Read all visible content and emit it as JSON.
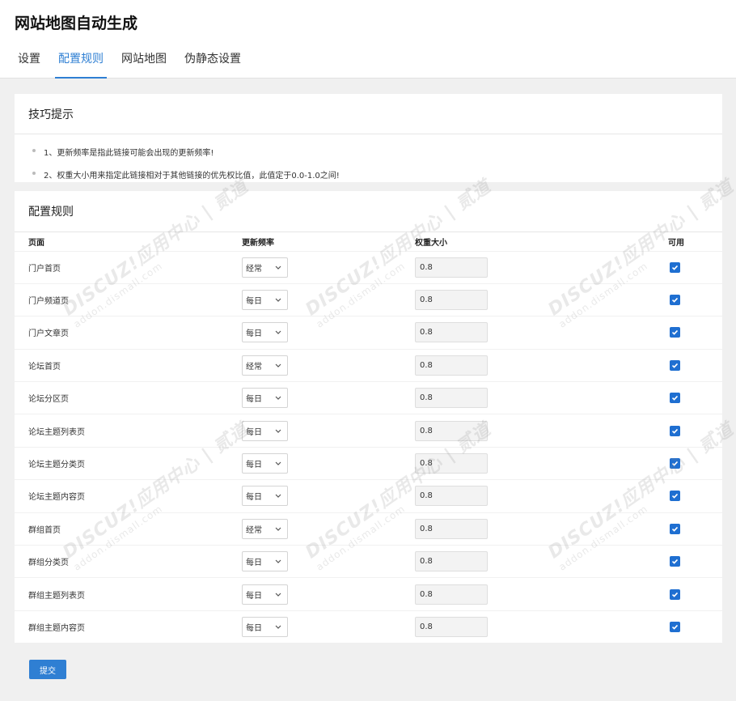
{
  "header": {
    "title": "网站地图自动生成",
    "tabs": [
      {
        "label": "设置",
        "active": false
      },
      {
        "label": "配置规则",
        "active": true
      },
      {
        "label": "网站地图",
        "active": false
      },
      {
        "label": "伪静态设置",
        "active": false
      }
    ]
  },
  "tips": {
    "title": "技巧提示",
    "items": [
      "1、更新频率是指此链接可能会出现的更新频率!",
      "2、权重大小用来指定此链接相对于其他链接的优先权比值，此值定于0.0-1.0之间!"
    ]
  },
  "rules": {
    "title": "配置规则",
    "columns": [
      "页面",
      "更新频率",
      "权重大小",
      "可用"
    ],
    "rows": [
      {
        "page": "门户首页",
        "freq": "经常",
        "weight": "0.8",
        "enabled": true
      },
      {
        "page": "门户频道页",
        "freq": "每日",
        "weight": "0.8",
        "enabled": true
      },
      {
        "page": "门户文章页",
        "freq": "每日",
        "weight": "0.8",
        "enabled": true
      },
      {
        "page": "论坛首页",
        "freq": "经常",
        "weight": "0.8",
        "enabled": true
      },
      {
        "page": "论坛分区页",
        "freq": "每日",
        "weight": "0.8",
        "enabled": true
      },
      {
        "page": "论坛主题列表页",
        "freq": "每日",
        "weight": "0.8",
        "enabled": true
      },
      {
        "page": "论坛主题分类页",
        "freq": "每日",
        "weight": "0.8",
        "enabled": true
      },
      {
        "page": "论坛主题内容页",
        "freq": "每日",
        "weight": "0.8",
        "enabled": true
      },
      {
        "page": "群组首页",
        "freq": "经常",
        "weight": "0.8",
        "enabled": true
      },
      {
        "page": "群组分类页",
        "freq": "每日",
        "weight": "0.8",
        "enabled": true
      },
      {
        "page": "群组主题列表页",
        "freq": "每日",
        "weight": "0.8",
        "enabled": true
      },
      {
        "page": "群组主题内容页",
        "freq": "每日",
        "weight": "0.8",
        "enabled": true
      }
    ]
  },
  "submit_label": "提交",
  "watermark": {
    "logo": "DISCUZ!应用中心 | 贰道",
    "url": "addon.dismall.com"
  },
  "colors": {
    "accent": "#2f7fd3",
    "checkbox": "#1f6fd1",
    "background": "#f0f0f0"
  }
}
